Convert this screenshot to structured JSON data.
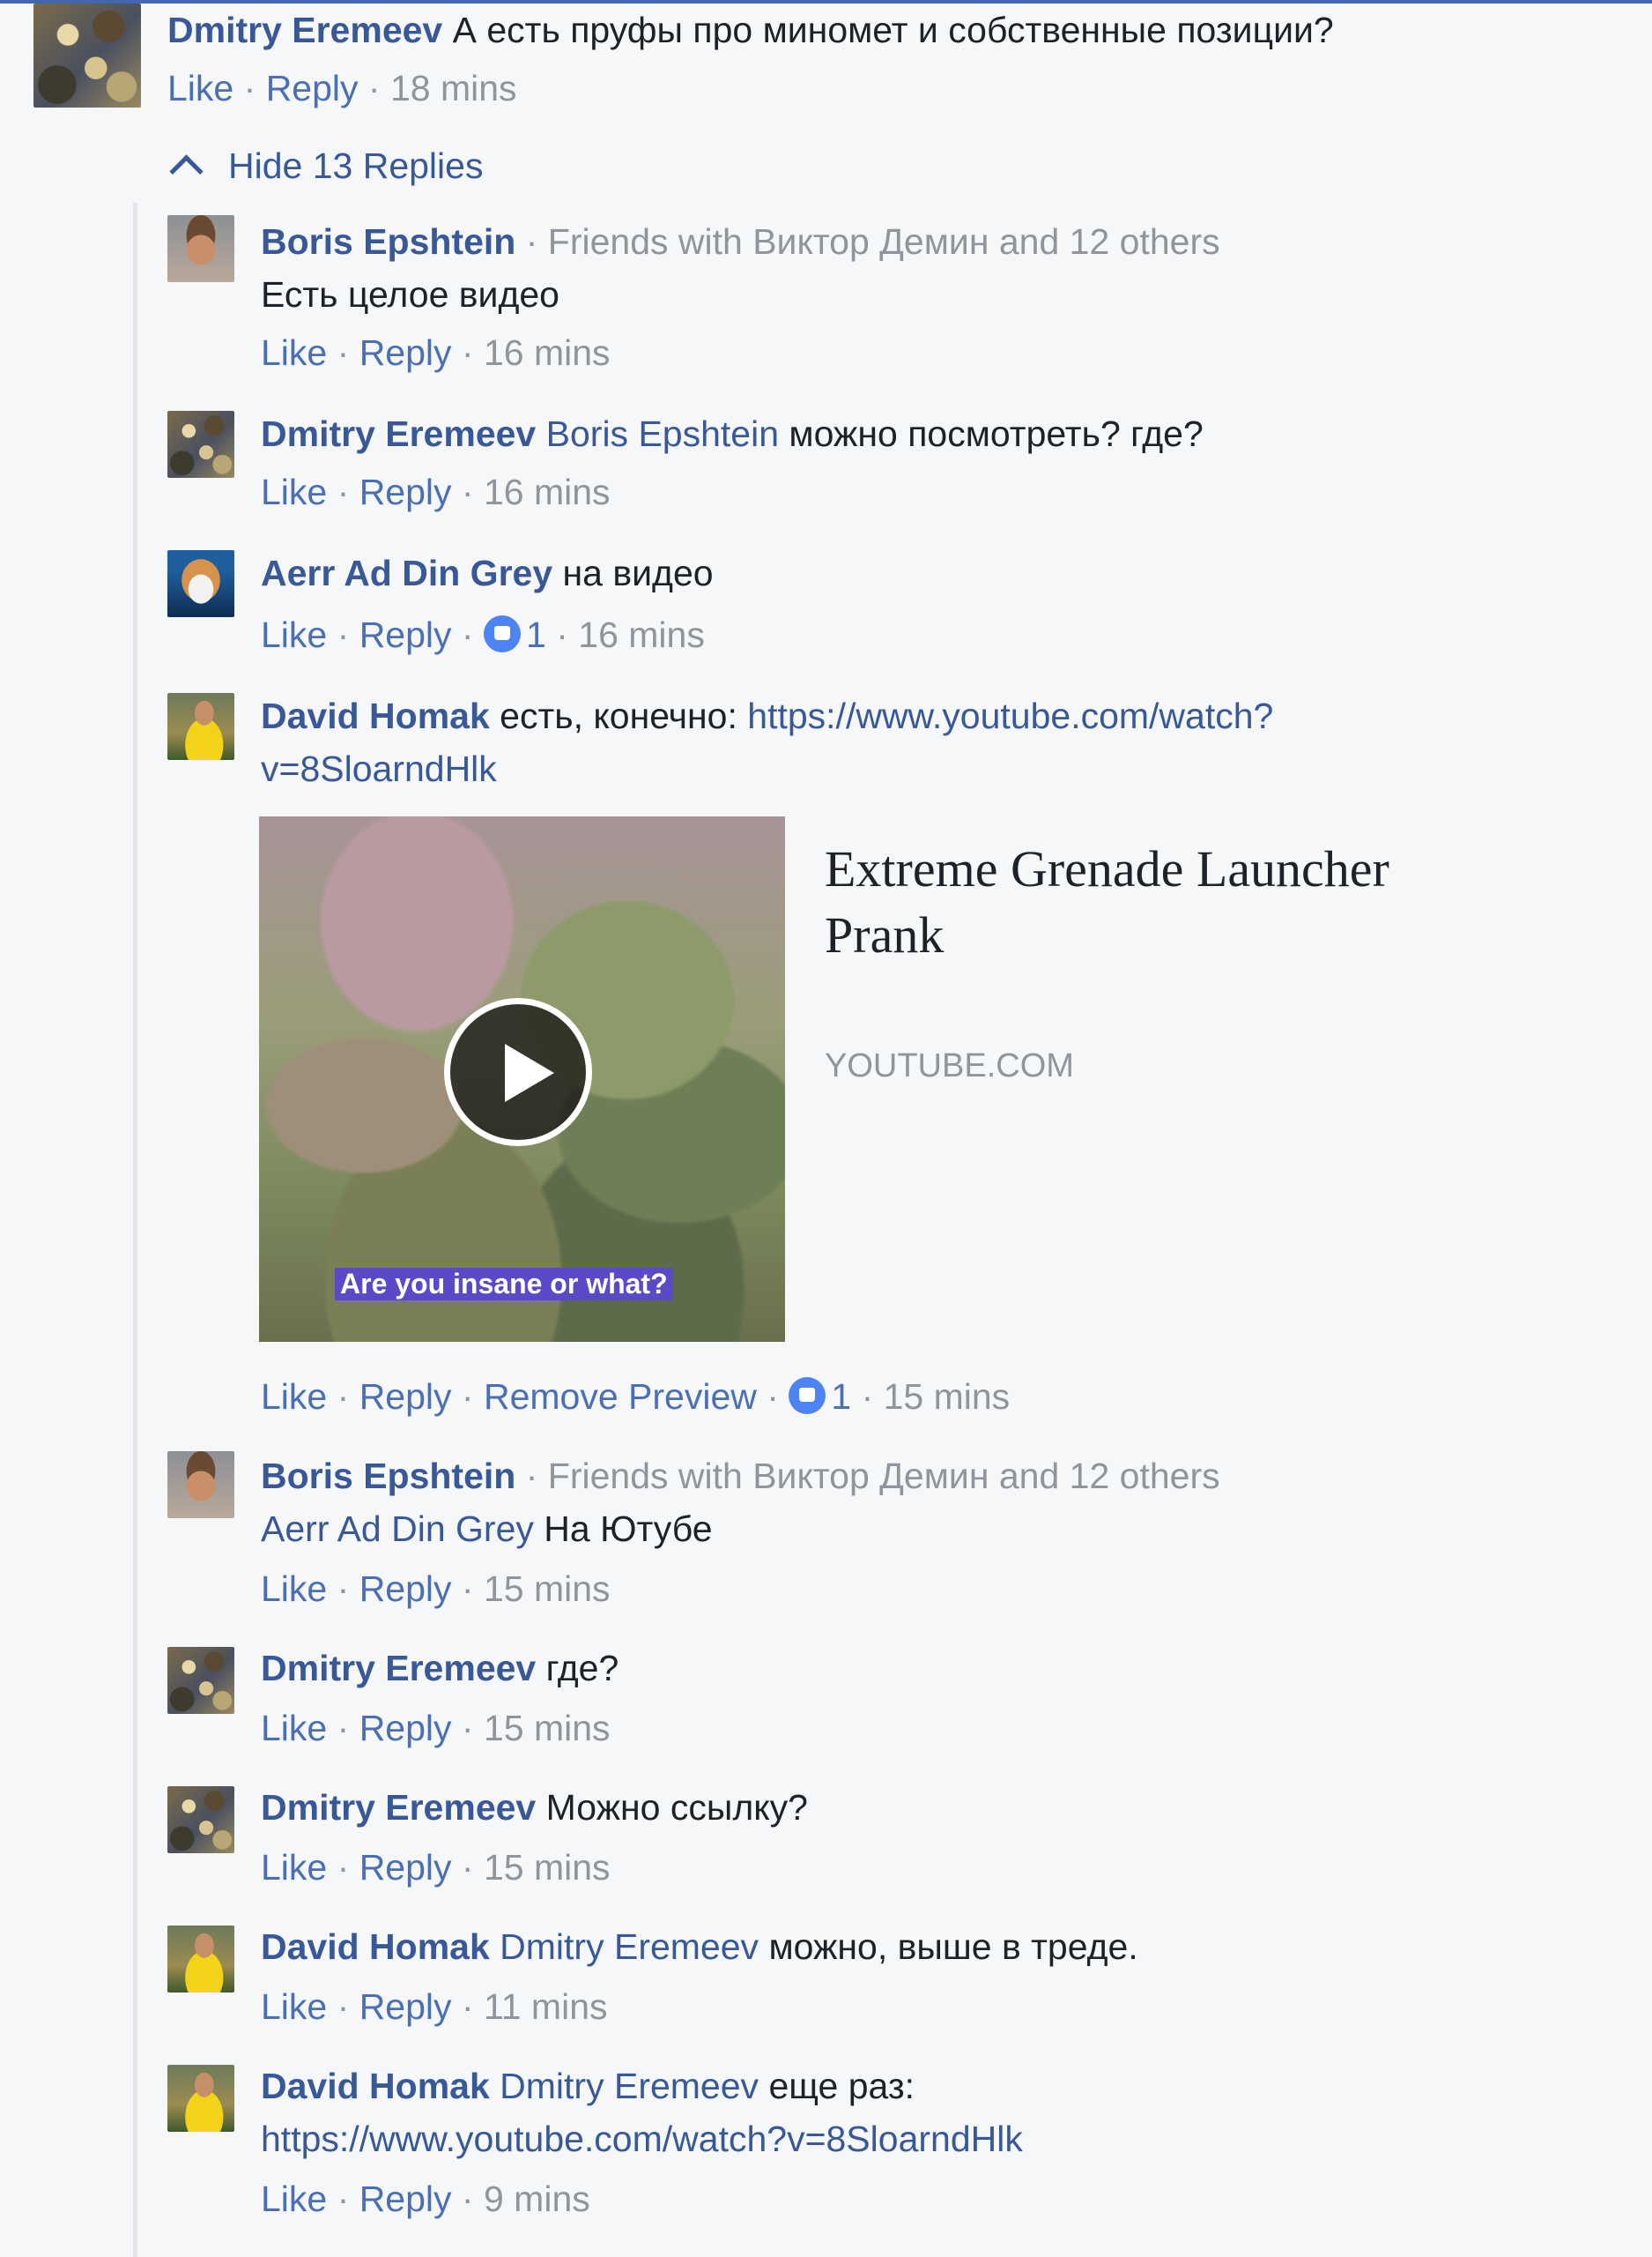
{
  "top_comment": {
    "author": "Dmitry Eremeev",
    "text": "А есть пруфы про миномет и собственные позиции?",
    "like_label": "Like",
    "reply_label": "Reply",
    "time": "18 mins"
  },
  "hide_replies_label": "Hide 13 Replies",
  "separator": "·",
  "replies": [
    {
      "author": "Boris Epshtein",
      "friends_note": "Friends with Виктор Демин and 12 others",
      "text": "Есть целое видео",
      "like_label": "Like",
      "reply_label": "Reply",
      "time": "16 mins"
    },
    {
      "author": "Dmitry Eremeev",
      "mention": "Boris Epshtein",
      "text": "можно посмотреть? где?",
      "like_label": "Like",
      "reply_label": "Reply",
      "time": "16 mins"
    },
    {
      "author": "Aerr Ad Din Grey",
      "text": "на видео",
      "like_label": "Like",
      "reply_label": "Reply",
      "reaction_count": "1",
      "time": "16 mins"
    },
    {
      "author": "David Homak",
      "text": "есть, конечно:",
      "link_part1": "https://www.youtube.com/watch?",
      "link_part2": "v=8SloarndHlk",
      "like_label": "Like",
      "reply_label": "Reply",
      "remove_preview_label": "Remove Preview",
      "reaction_count": "1",
      "time": "15 mins"
    },
    {
      "author": "Boris Epshtein",
      "friends_note": "Friends with Виктор Демин and 12 others",
      "mention": "Aerr Ad Din Grey",
      "text": "На Ютубе",
      "like_label": "Like",
      "reply_label": "Reply",
      "time": "15 mins"
    },
    {
      "author": "Dmitry Eremeev",
      "text": "где?",
      "like_label": "Like",
      "reply_label": "Reply",
      "time": "15 mins"
    },
    {
      "author": "Dmitry Eremeev",
      "text": "Можно ссылку?",
      "like_label": "Like",
      "reply_label": "Reply",
      "time": "15 mins"
    },
    {
      "author": "David Homak",
      "mention": "Dmitry Eremeev",
      "text": "можно, выше в треде.",
      "like_label": "Like",
      "reply_label": "Reply",
      "time": "11 mins"
    },
    {
      "author": "David Homak",
      "mention": "Dmitry Eremeev",
      "text": "еще раз:",
      "link": "https://www.youtube.com/watch?v=8SloarndHlk",
      "like_label": "Like",
      "reply_label": "Reply",
      "time": "9 mins"
    }
  ],
  "link_preview": {
    "title": "Extreme Grenade Launcher Prank",
    "domain": "YOUTUBE.COM",
    "caption": "Are you insane or what?",
    "icon": "play-icon"
  },
  "colors": {
    "name": "#385898",
    "action": "#4b6fb5",
    "meta": "#90949c",
    "background": "#f6f7f9",
    "like_badge": "#4d83f3"
  }
}
